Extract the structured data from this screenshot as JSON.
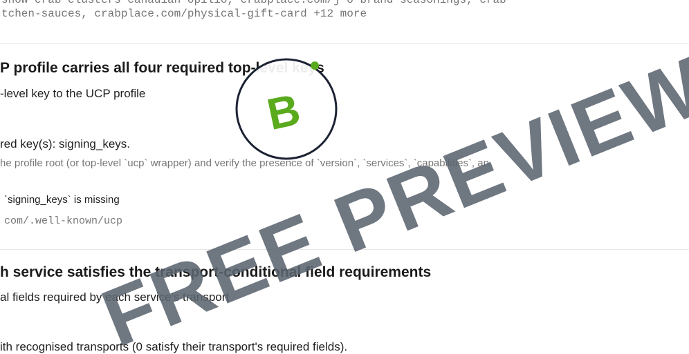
{
  "top": {
    "line1": "show crab clusters canadian opilio, crabplace.com/j o brand seasonings, crab",
    "line2": "tchen-sauces, crabplace.com/physical-gift-card +12 more"
  },
  "check1": {
    "title": "P profile carries all four required top-level keys",
    "desc": "-level key to the UCP profile",
    "finding": "red key(s): signing_keys.",
    "detail": "he profile root (or top-level `ucp` wrapper) and verify the presence of `version`, `services`, `capabilities`, an",
    "issue": "`signing_keys` is missing",
    "url": "com/.well-known/ucp"
  },
  "check2": {
    "title": "h service satisfies the transport-conditional field requirements",
    "desc": "al fields required by each service's transport",
    "finding": "ith recognised transports (0 satisfy their transport's required fields)."
  },
  "watermark": {
    "text": "FREE PREVIEW",
    "badge_letter": "B",
    "color": "#5b6470",
    "badge_green": "#5aaa1e",
    "badge_ring": "#1b2233"
  }
}
